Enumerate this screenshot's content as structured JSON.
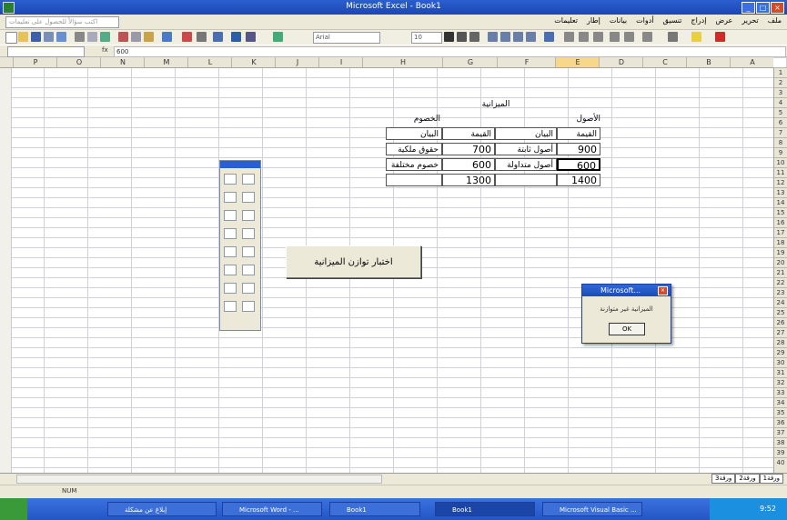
{
  "window": {
    "title": "Microsoft Excel - Book1"
  },
  "menubar": {
    "help_placeholder": "اكتب سؤالاً للحصول على تعليمات",
    "items": [
      "ملف",
      "تحرير",
      "عرض",
      "إدراج",
      "تنسيق",
      "أدوات",
      "بيانات",
      "إطار",
      "تعليمات"
    ]
  },
  "toolbar": {
    "font": "Arial",
    "size": "10"
  },
  "formula": {
    "namebox": "",
    "fx_label": "fx",
    "value": "600"
  },
  "columns": [
    "P",
    "O",
    "N",
    "M",
    "L",
    "K",
    "J",
    "I",
    "H",
    "G",
    "F",
    "E",
    "D",
    "C",
    "B",
    "A"
  ],
  "sheet": {
    "title": "الميزانية",
    "assets_header": "الأصول",
    "liabilities_header": "الخصوم",
    "value_label_1": "القيمة",
    "desc_label_1": "البيان",
    "value_label_2": "القيمة",
    "desc_label_2": "البيان",
    "rows": [
      {
        "asset_value": "900",
        "asset_desc": "أصول ثابتة",
        "liab_value": "700",
        "liab_desc": "حقوق ملكية"
      },
      {
        "asset_value": "600",
        "asset_desc": "أصول متداولة",
        "liab_value": "600",
        "liab_desc": "خصوم مختلفة"
      }
    ],
    "asset_total": "1400",
    "liab_total": "1300"
  },
  "sheet_button": {
    "label": "اختبار توازن الميزانية"
  },
  "msgbox": {
    "title": "Microsoft...",
    "message": "الميزانية غير متوازنة",
    "ok": "OK"
  },
  "sheet_tabs": [
    "ورقة1",
    "ورقة2",
    "ورقة3"
  ],
  "status": {
    "mode": "NUM"
  },
  "taskbar": {
    "tasks": [
      "إبلاغ عن مشكلة",
      "Microsoft Word - ...",
      "Book1",
      "Book1",
      "Microsoft Visual Basic ..."
    ],
    "clock": "9:52"
  }
}
